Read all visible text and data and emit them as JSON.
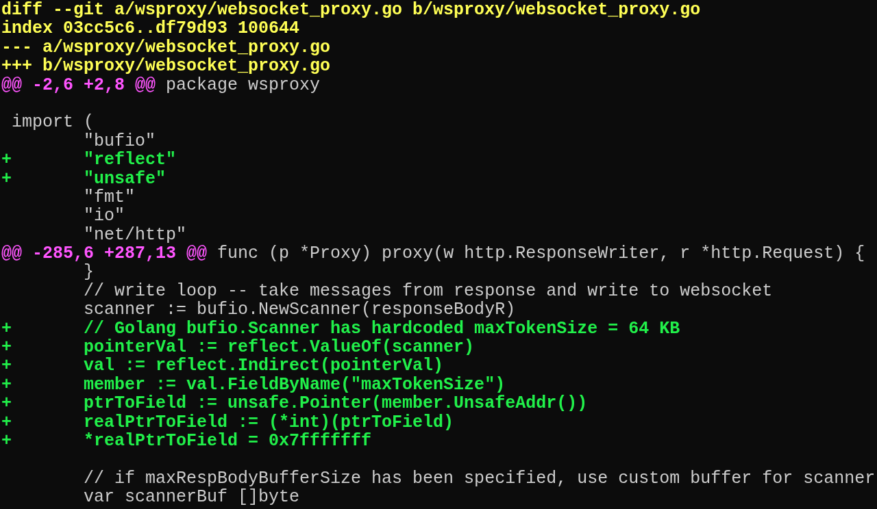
{
  "diff_lines": [
    {
      "kind": "file_header",
      "text": "diff --git a/wsproxy/websocket_proxy.go b/wsproxy/websocket_proxy.go"
    },
    {
      "kind": "file_header",
      "text": "index 03cc5c6..df79d93 100644"
    },
    {
      "kind": "file_header",
      "text": "--- a/wsproxy/websocket_proxy.go"
    },
    {
      "kind": "file_header",
      "text": "+++ b/wsproxy/websocket_proxy.go"
    },
    {
      "kind": "hunk",
      "range": "@@ -2,6 +2,8 @@",
      "context": "package wsproxy"
    },
    {
      "kind": "blank"
    },
    {
      "kind": "context",
      "text": " import ("
    },
    {
      "kind": "context",
      "text": " \t\"bufio\""
    },
    {
      "kind": "added",
      "text": "+\t\"reflect\""
    },
    {
      "kind": "added",
      "text": "+\t\"unsafe\""
    },
    {
      "kind": "context",
      "text": " \t\"fmt\""
    },
    {
      "kind": "context",
      "text": " \t\"io\""
    },
    {
      "kind": "context",
      "text": " \t\"net/http\""
    },
    {
      "kind": "hunk",
      "range": "@@ -285,6 +287,13 @@",
      "context": "func (p *Proxy) proxy(w http.ResponseWriter, r *http.Request) {"
    },
    {
      "kind": "context",
      "text": " \t}"
    },
    {
      "kind": "context",
      "text": " \t// write loop -- take messages from response and write to websocket"
    },
    {
      "kind": "context",
      "text": " \tscanner := bufio.NewScanner(responseBodyR)"
    },
    {
      "kind": "added",
      "text": "+\t// Golang bufio.Scanner has hardcoded maxTokenSize = 64 KB"
    },
    {
      "kind": "added",
      "text": "+\tpointerVal := reflect.ValueOf(scanner)"
    },
    {
      "kind": "added",
      "text": "+\tval := reflect.Indirect(pointerVal)"
    },
    {
      "kind": "added",
      "text": "+\tmember := val.FieldByName(\"maxTokenSize\")"
    },
    {
      "kind": "added",
      "text": "+\tptrToField := unsafe.Pointer(member.UnsafeAddr())"
    },
    {
      "kind": "added",
      "text": "+\trealPtrToField := (*int)(ptrToField)"
    },
    {
      "kind": "added",
      "text": "+\t*realPtrToField = 0x7fffffff"
    },
    {
      "kind": "blank"
    },
    {
      "kind": "context",
      "text": " \t// if maxRespBodyBufferSize has been specified, use custom buffer for scanner"
    },
    {
      "kind": "context",
      "text": " \tvar scannerBuf []byte"
    }
  ]
}
